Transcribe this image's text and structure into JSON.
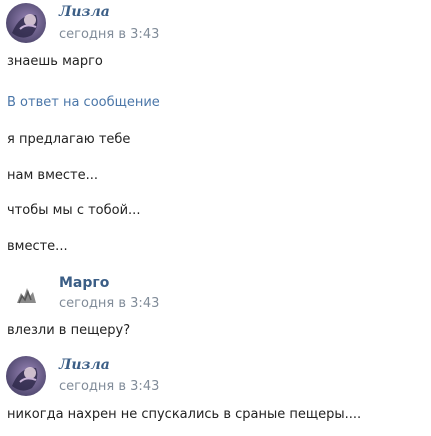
{
  "posts": [
    {
      "author": "Лизла",
      "time": "сегодня в 3:43",
      "messages": [
        "знаешь марго"
      ],
      "reply_label": "В ответ на сообщение",
      "quoted": [
        "я предлагаю тебе",
        "нам вместе...",
        "чтобы мы с тобой...",
        "вместе..."
      ]
    },
    {
      "author": "Марго",
      "time": "сегодня в 3:43",
      "messages": [
        "влезли в пещеру?"
      ]
    },
    {
      "author": "Лизла",
      "time": "сегодня в 3:43",
      "messages": [
        "никогда нахрен не спускались в сраные пещеры...."
      ]
    }
  ],
  "colors": {
    "author": "#3b5e86",
    "time": "#818c99",
    "reply_link": "#4a76a8",
    "text": "#222222"
  }
}
